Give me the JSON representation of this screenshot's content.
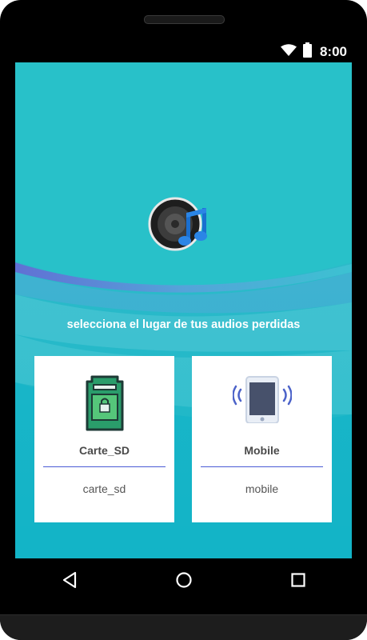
{
  "status_bar": {
    "time": "8:00",
    "icons": [
      "wifi-icon",
      "battery-icon"
    ]
  },
  "main": {
    "logo_icon": "speaker-music-note-icon",
    "prompt": "selecciona el lugar de tus audios perdidas",
    "cards": [
      {
        "title": "Carte_SD",
        "subtitle": "carte_sd",
        "icon": "sd-card-icon"
      },
      {
        "title": "Mobile",
        "subtitle": "mobile",
        "icon": "phone-vibrate-icon"
      }
    ]
  },
  "nav_bar": {
    "buttons": [
      "back-icon",
      "home-icon",
      "recents-icon"
    ]
  },
  "colors": {
    "screen_background": "#28c1c9",
    "card_background": "#ffffff",
    "divider": "#4a5bd6",
    "bezel": "#000000"
  }
}
